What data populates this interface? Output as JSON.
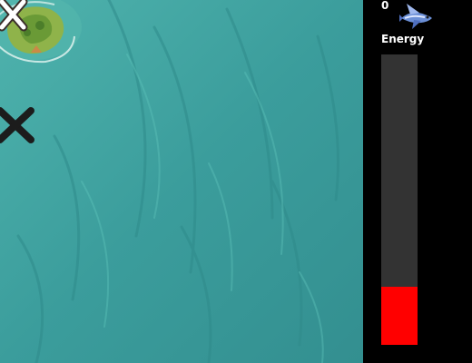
{
  "hud": {
    "score": "0",
    "energy_label": "Energy",
    "energy_level": 0.2,
    "fish_icon": "flying-fish-icon"
  },
  "playfield": {
    "ocean_color": "#3b9d9c",
    "island_icon": "island-icon",
    "markers": [
      "x-marker-icon",
      "x-marker-icon"
    ]
  },
  "colors": {
    "energy_fill": "#ff0000",
    "energy_track": "#333333",
    "hud_background": "#000000",
    "text": "#ffffff"
  }
}
